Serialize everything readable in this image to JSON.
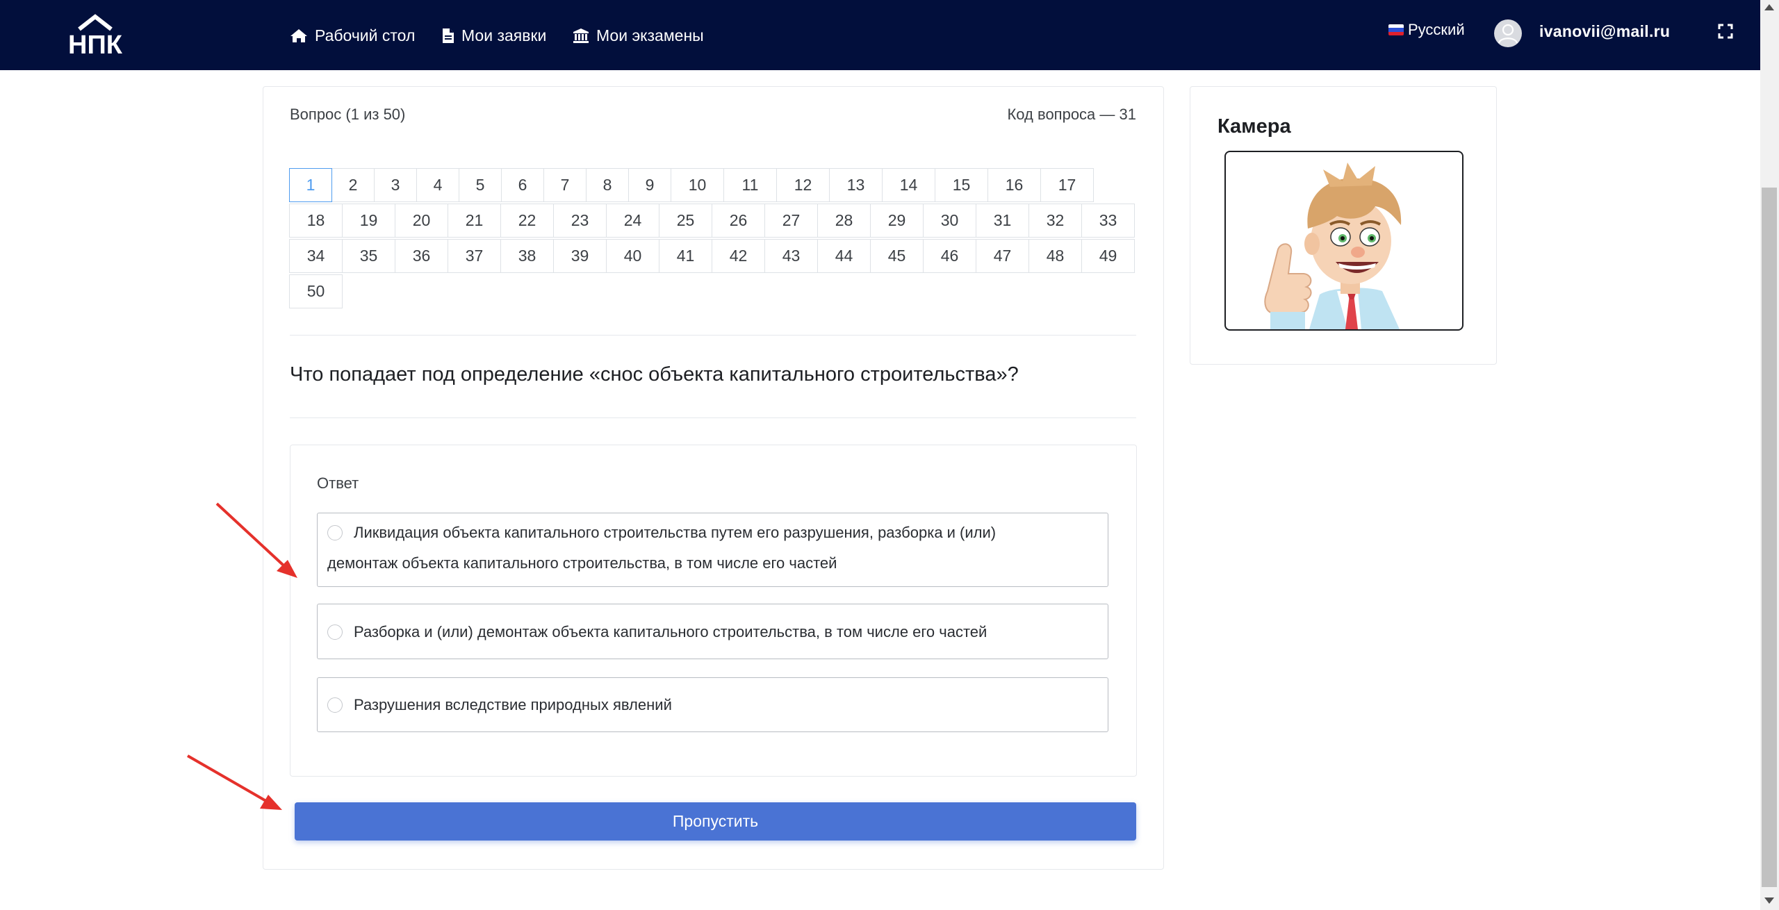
{
  "navbar": {
    "logo_text": "НПК",
    "items": [
      {
        "label": "Рабочий стол",
        "icon": "home-icon"
      },
      {
        "label": "Мои заявки",
        "icon": "document-icon"
      },
      {
        "label": "Мои экзамены",
        "icon": "institution-icon"
      }
    ],
    "language": "Русский",
    "user_email": "ivanovii@mail.ru",
    "background": "#020f3c"
  },
  "question": {
    "counter": "Вопрос (1 из 50)",
    "code": "Код вопроса — 31",
    "text": "Что попадает под определение «снос объекта капитального строительства»?",
    "current": 1,
    "numbers": {
      "row1": [
        "1",
        "2",
        "3",
        "4",
        "5",
        "6",
        "7",
        "8",
        "9",
        "10",
        "11",
        "12",
        "13",
        "14",
        "15",
        "16",
        "17"
      ],
      "row2": [
        "18",
        "19",
        "20",
        "21",
        "22",
        "23",
        "24",
        "25",
        "26",
        "27",
        "28",
        "29",
        "30",
        "31",
        "32",
        "33"
      ],
      "row3": [
        "34",
        "35",
        "36",
        "37",
        "38",
        "39",
        "40",
        "41",
        "42",
        "43",
        "44",
        "45",
        "46",
        "47",
        "48",
        "49"
      ],
      "row4": [
        "50"
      ]
    }
  },
  "answer": {
    "label": "Ответ",
    "options": [
      {
        "line1": "Ликвидация объекта капитального строительства путем его разрушения, разборка и (или)",
        "line2": "демонтаж объекта капитального строительства, в том числе его частей"
      },
      {
        "text": "Разборка и (или) демонтаж объекта капитального строительства, в том числе его частей"
      },
      {
        "text": "Разрушения вследствие природных явлений"
      }
    ]
  },
  "skip_button": "Пропустить",
  "camera": {
    "title": "Камера"
  },
  "colors": {
    "accent": "#4a73d4",
    "active_number": "#4f9cef",
    "annotation_arrow": "#e5312b"
  }
}
